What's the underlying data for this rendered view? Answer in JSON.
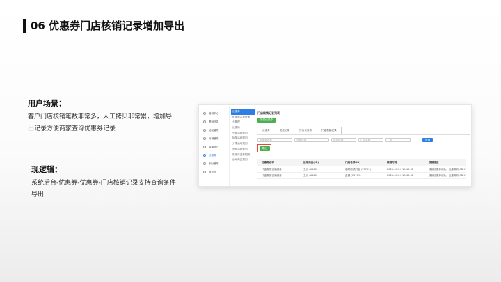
{
  "title": "06 优惠券门店核销记录增加导出",
  "scene": {
    "heading": "用户场景：",
    "text": "客户门店核销笔数非常多，人工拷贝非常累，增加导出记录方便商家查询优惠券记录"
  },
  "logic": {
    "heading": "现逻辑：",
    "text": "系统后台-优惠券-优惠券-门店核销记录支持查询条件导出"
  },
  "screenshot": {
    "sidebar": [
      {
        "label": "营销中心",
        "active": false
      },
      {
        "label": "基础信息",
        "active": false
      },
      {
        "label": "活动管理",
        "active": false
      },
      {
        "label": "分销管理",
        "active": false
      },
      {
        "label": "整单统计",
        "active": false
      },
      {
        "label": "优惠券",
        "active": true
      },
      {
        "label": "积分管理",
        "active": false
      },
      {
        "label": "盘点仓",
        "active": false
      }
    ],
    "submenu": [
      {
        "label": "优惠券",
        "active": true
      },
      {
        "label": "优惠券发放设置",
        "active": false
      },
      {
        "label": "卡管理",
        "active": false
      },
      {
        "label": "优惠码",
        "active": false
      },
      {
        "label": "分组活动规则",
        "active": false
      },
      {
        "label": "抽奖活动规则",
        "active": false
      },
      {
        "label": "分享活动规则",
        "active": false
      },
      {
        "label": "领券活动规则",
        "active": false
      },
      {
        "label": "新用户送券规则",
        "active": false
      },
      {
        "label": "活动商品规则",
        "active": false
      }
    ],
    "crumb": "门店核销记录列表",
    "new_button": "新建优惠券",
    "tabs": [
      {
        "label": "优惠券",
        "active": false
      },
      {
        "label": "发放记录",
        "active": false
      },
      {
        "label": "所有优惠券",
        "active": false
      },
      {
        "label": "门店核销记录",
        "active": true
      }
    ],
    "filters": [
      "优惠券名称",
      "开始时间",
      "结束时间",
      "门店名称",
      "门店"
    ],
    "query_button": "查询",
    "export_button": "导出",
    "table": {
      "headers": [
        "优惠券名称",
        "适用商品(ID)",
        "门店名称(ID)",
        "核销时间",
        "核销描述"
      ],
      "rows": [
        [
          "代金券测试满减券",
          "五元 (6860)",
          "临时测试门店 (13709)",
          "2021-03-24 15:40:02",
          "核销优惠券成功，优惠券码:SDH1598"
        ],
        [
          "代金券测试满减券",
          "五元 (6860)",
          "盘锦 (13709)",
          "2021-03-24 15:40:02",
          "核销优惠券成功，优惠券码:SDH1598"
        ]
      ]
    }
  }
}
